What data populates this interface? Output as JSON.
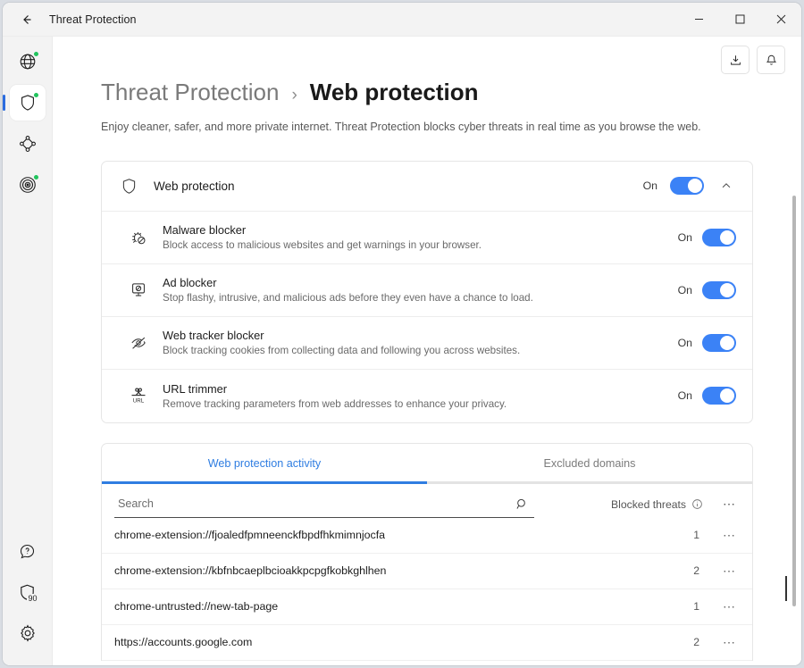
{
  "window": {
    "title": "Threat Protection",
    "back_icon": "arrow-left-icon",
    "minimize_label": "—",
    "maximize_label": "□",
    "close_label": "✕"
  },
  "sidebar": {
    "items": [
      {
        "name": "vpn",
        "icon": "globe-icon",
        "badge": true,
        "active": false
      },
      {
        "name": "threat-protection",
        "icon": "shield-icon",
        "badge": true,
        "active": true
      },
      {
        "name": "meshnet",
        "icon": "meshnet-icon",
        "badge": false,
        "active": false
      },
      {
        "name": "dark-web-monitor",
        "icon": "radar-icon",
        "badge": true,
        "active": false
      }
    ],
    "bottom_items": [
      {
        "name": "help",
        "icon": "help-icon",
        "label": ""
      },
      {
        "name": "protection-score",
        "icon": "shield-score-icon",
        "label": "90"
      },
      {
        "name": "settings",
        "icon": "gear-icon",
        "label": ""
      }
    ]
  },
  "top_actions": [
    {
      "name": "downloads",
      "icon": "download-icon"
    },
    {
      "name": "notifications",
      "icon": "bell-icon"
    }
  ],
  "header": {
    "crumb_parent": "Threat Protection",
    "crumb_separator": "›",
    "crumb_current": "Web protection",
    "subtitle": "Enjoy cleaner, safer, and more private internet. Threat Protection blocks cyber threats in real time as you browse the web."
  },
  "master": {
    "icon": "shield-icon",
    "label": "Web protection",
    "state": "On",
    "toggle_on": true,
    "collapse_icon": "chevron-up-icon"
  },
  "features": [
    {
      "icon": "malware-bug-blocked-icon",
      "title": "Malware blocker",
      "desc": "Block access to malicious websites and get warnings in your browser.",
      "state": "On",
      "toggle_on": true
    },
    {
      "icon": "ad-blocked-monitor-icon",
      "title": "Ad blocker",
      "desc": "Stop flashy, intrusive, and malicious ads before they even have a chance to load.",
      "state": "On",
      "toggle_on": true
    },
    {
      "icon": "eye-off-icon",
      "title": "Web tracker blocker",
      "desc": "Block tracking cookies from collecting data and following you across websites.",
      "state": "On",
      "toggle_on": true
    },
    {
      "icon": "url-trim-scissors-icon",
      "title": "URL trimmer",
      "desc": "Remove tracking parameters from web addresses to enhance your privacy.",
      "state": "On",
      "toggle_on": true
    }
  ],
  "activity": {
    "tabs": [
      {
        "label": "Web protection activity",
        "active": true
      },
      {
        "label": "Excluded domains",
        "active": false
      }
    ],
    "search": {
      "value": "",
      "placeholder": "Search",
      "icon": "search-icon"
    },
    "column_header": {
      "label": "Blocked threats",
      "info_icon": "info-icon",
      "more_icon": "more-horizontal-icon"
    },
    "rows": [
      {
        "url": "chrome-extension://fjoaledfpmneenckfbpdfhkmimnjocfa",
        "count": "1",
        "more_icon": "more-horizontal-icon"
      },
      {
        "url": "chrome-extension://kbfnbcaeplbcioakkpcpgfkobkghlhen",
        "count": "2",
        "more_icon": "more-horizontal-icon"
      },
      {
        "url": "chrome-untrusted://new-tab-page",
        "count": "1",
        "more_icon": "more-horizontal-icon"
      },
      {
        "url": "https://accounts.google.com",
        "count": "2",
        "more_icon": "more-horizontal-icon"
      }
    ]
  },
  "colors": {
    "accent": "#3b82f6",
    "tab_active": "#2f7de1",
    "badge_green": "#21c45d",
    "sidebar_bg": "#f3f3f3"
  }
}
